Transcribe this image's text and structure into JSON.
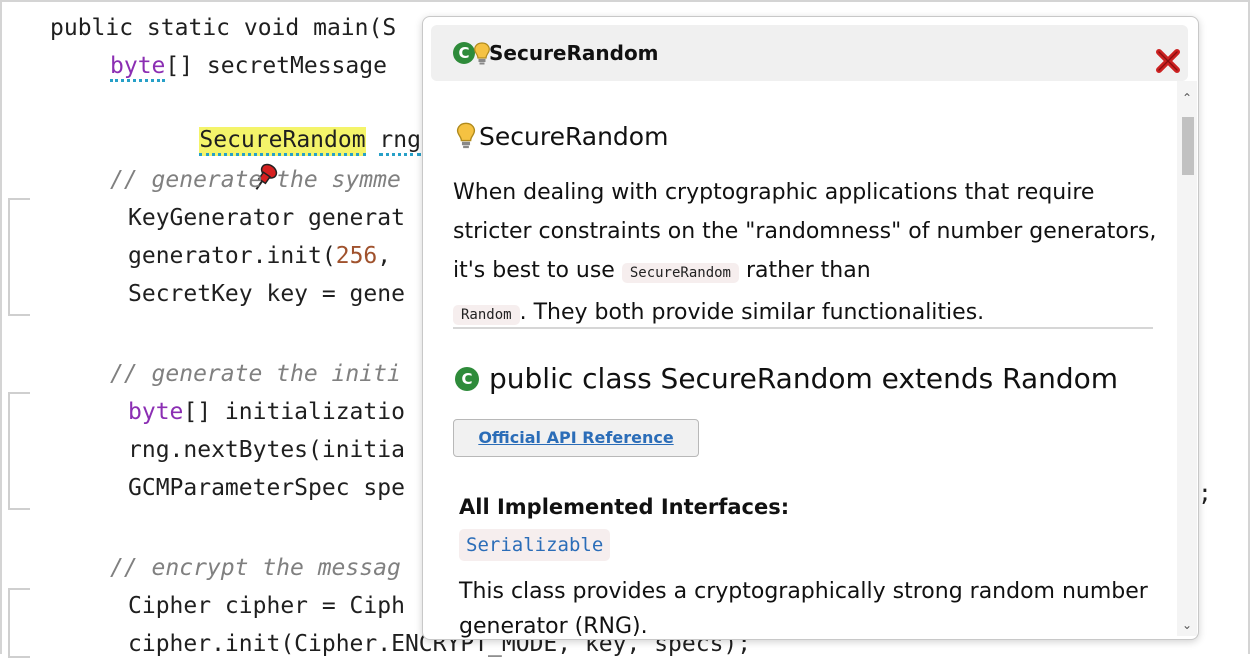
{
  "code": {
    "lines": [
      "public static void main(S",
      "byte[] secretMessage",
      "SecureRandom rng =",
      "// generate the symme",
      "KeyGenerator generat",
      "generator.init(256,",
      "SecretKey key = gene",
      "// generate the initi",
      "byte[] initializatio",
      "rng.nextBytes(initia",
      "GCMParameterSpec spe",
      "// encrypt the messag",
      "Cipher cipher = Ciph",
      "cipher.init(Cipher.ENCRYPT_MODE, key, specs);"
    ],
    "line3_tail": ";"
  },
  "popup": {
    "title": "SecureRandom",
    "heading": "SecureRandom",
    "description_parts": [
      "When dealing with cryptographic applications that require stricter constraints on the \"randomness\" of number generators, it's best to use",
      "SecureRandom",
      "rather than",
      "Random",
      ". They both provide similar functionalities."
    ],
    "class_signature": "public class SecureRandom extends Random",
    "api_button": "Official API Reference",
    "implemented_heading": "All Implemented Interfaces:",
    "implemented_item": "Serializable",
    "class_description": "This class provides a cryptographically strong random number generator (RNG).",
    "class_icon_letter": "C"
  },
  "colors": {
    "keyword": "#8b2eb3",
    "number": "#a0522d",
    "comment": "#808080",
    "highlight": "#f4f46a",
    "icon_green": "#2e8b3a",
    "link": "#2b6db8",
    "close_red": "#cc2222"
  },
  "icons": [
    "pin-icon",
    "class-icon",
    "lightbulb-icon",
    "close-icon",
    "scroll-up-icon",
    "scroll-down-icon"
  ]
}
